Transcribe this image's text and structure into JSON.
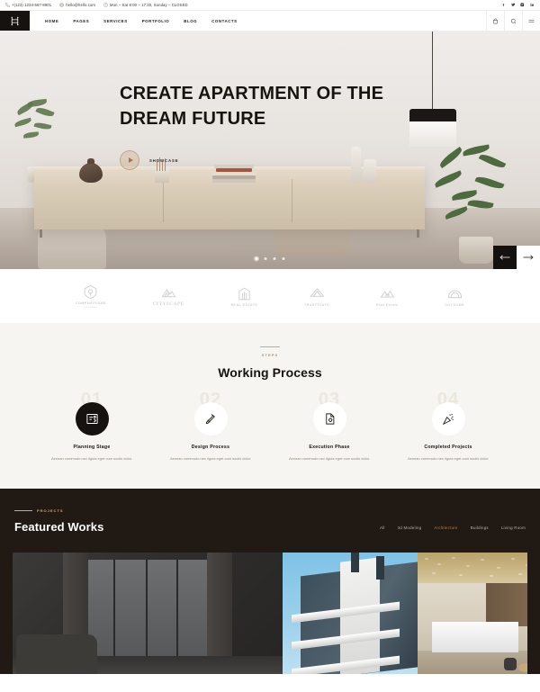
{
  "topbar": {
    "phone": "+(123) 1234-567-8901",
    "email": "hello@hello.com",
    "hours": "Mon – Sat 8:00 – 17:30, Sunday – CLOSED",
    "socials": [
      "facebook-icon",
      "twitter-icon",
      "instagram-icon",
      "linkedin-icon"
    ]
  },
  "header": {
    "logo_alt": "site-logo",
    "nav": [
      {
        "label": "HOME"
      },
      {
        "label": "PAGES"
      },
      {
        "label": "SERVICES"
      },
      {
        "label": "PORTFOLIO"
      },
      {
        "label": "BLOG"
      },
      {
        "label": "CONTACTS"
      }
    ],
    "icons": [
      "cart-icon",
      "search-icon",
      "menu-icon"
    ]
  },
  "hero": {
    "title_line1": "CREATE APARTMENT OF THE",
    "title_line2": "DREAM FUTURE",
    "cta_label": "SHOWCASE",
    "play_icon": "play-icon",
    "slides_total": 4,
    "slide_active": 1,
    "prev_label": "previous-slide",
    "next_label": "next-slide"
  },
  "clients": [
    {
      "name": "COMPANYNAME",
      "sub": "real estate",
      "icon": "house-shield-logo",
      "serif": false
    },
    {
      "name": "CITYSCAPE",
      "sub": "",
      "icon": "cityscape-logo",
      "serif": true
    },
    {
      "name": "REAL ESTATE",
      "sub": "",
      "icon": "building-logo",
      "serif": false
    },
    {
      "name": "TRUSTSTATE",
      "sub": "",
      "icon": "roof-logo",
      "serif": false
    },
    {
      "name": "Real Estate",
      "sub": "",
      "icon": "mountain-home-logo",
      "serif": false
    },
    {
      "name": "DOTDOME",
      "sub": "",
      "icon": "dome-logo",
      "serif": false
    }
  ],
  "process": {
    "eyebrow": "STEPS",
    "title": "Working Process",
    "steps": [
      {
        "num": "01",
        "title": "Planning Stage",
        "desc": "Aenean commodo nec ligula eget cum sociis dolor.",
        "icon": "clipboard-plan-icon",
        "active": true
      },
      {
        "num": "02",
        "title": "Design Process",
        "desc": "Aenean commodo nec ligula eget cum sociis dolor.",
        "icon": "pencil-ruler-icon",
        "active": false
      },
      {
        "num": "03",
        "title": "Execution Phase",
        "desc": "Aenean commodo nec ligula eget cum sociis dolor.",
        "icon": "document-gear-icon",
        "active": false
      },
      {
        "num": "04",
        "title": "Completed Projects",
        "desc": "Aenean commodo nec ligula eget cum sociis dolor.",
        "icon": "confetti-icon",
        "active": false
      }
    ]
  },
  "works": {
    "eyebrow": "PROJECTS",
    "title": "Featured Works",
    "filters": [
      {
        "label": "All",
        "active": false
      },
      {
        "label": "3d Modeling",
        "active": false
      },
      {
        "label": "Architecture",
        "active": true
      },
      {
        "label": "Buildings",
        "active": false
      },
      {
        "label": "Living Room",
        "active": false
      }
    ],
    "items": [
      {
        "alt": "dark-living-room-project"
      },
      {
        "alt": "modern-building-facade-project"
      },
      {
        "alt": "hotel-lobby-interior-project"
      }
    ]
  },
  "colors": {
    "accent": "#c8783c",
    "gold": "#c8a888",
    "dark": "#211a14",
    "cream": "#f7f5f1"
  }
}
